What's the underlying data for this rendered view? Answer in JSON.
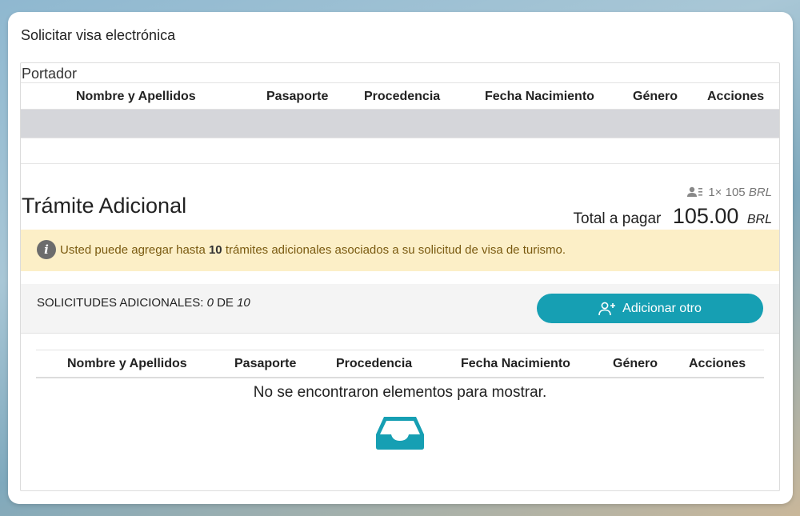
{
  "card": {
    "title": "Solicitar visa electrónica"
  },
  "portador": {
    "label": "Portador",
    "columns": [
      "Nombre y Apellidos",
      "Pasaporte",
      "Procedencia",
      "Fecha Nacimiento",
      "Género",
      "Acciones"
    ]
  },
  "tramite": {
    "title": "Trámite Adicional",
    "rate_count": "1×",
    "rate_price": "105",
    "rate_currency": "BRL",
    "total_label": "Total a pagar",
    "total_amount": "105.00",
    "total_currency": "BRL"
  },
  "alert": {
    "icon": "info-icon",
    "text_before": "Usted puede agregar hasta ",
    "max": "10",
    "text_after": " trámites adicionales asociados a su solicitud de visa de turismo."
  },
  "toolbar": {
    "counter_label": "SOLICITUDES ADICIONALES:",
    "counter_current": "0",
    "counter_of": "DE",
    "counter_max": "10",
    "add_button": "Adicionar otro"
  },
  "adicionales": {
    "columns": [
      "Nombre y Apellidos",
      "Pasaporte",
      "Procedencia",
      "Fecha Nacimiento",
      "Género",
      "Acciones"
    ],
    "empty_message": "No se encontraron elementos para mostrar."
  },
  "colors": {
    "accent": "#169fb3",
    "alert_bg": "#fcefc7",
    "alert_text": "#7a5a10",
    "row_bg": "#d5d6da"
  }
}
